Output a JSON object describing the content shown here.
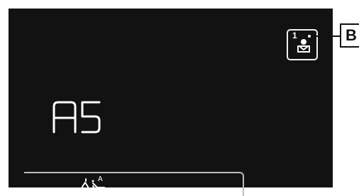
{
  "display": {
    "readout": "AS",
    "background_color": "#121212",
    "foreground_color": "#ffffff"
  },
  "profile_button": {
    "number": "1",
    "icon": "user-profile-icon"
  },
  "callout": {
    "label": "B"
  },
  "bottom_bar": {
    "icon": "auto-water-function-icon",
    "icon_badge": "A"
  }
}
